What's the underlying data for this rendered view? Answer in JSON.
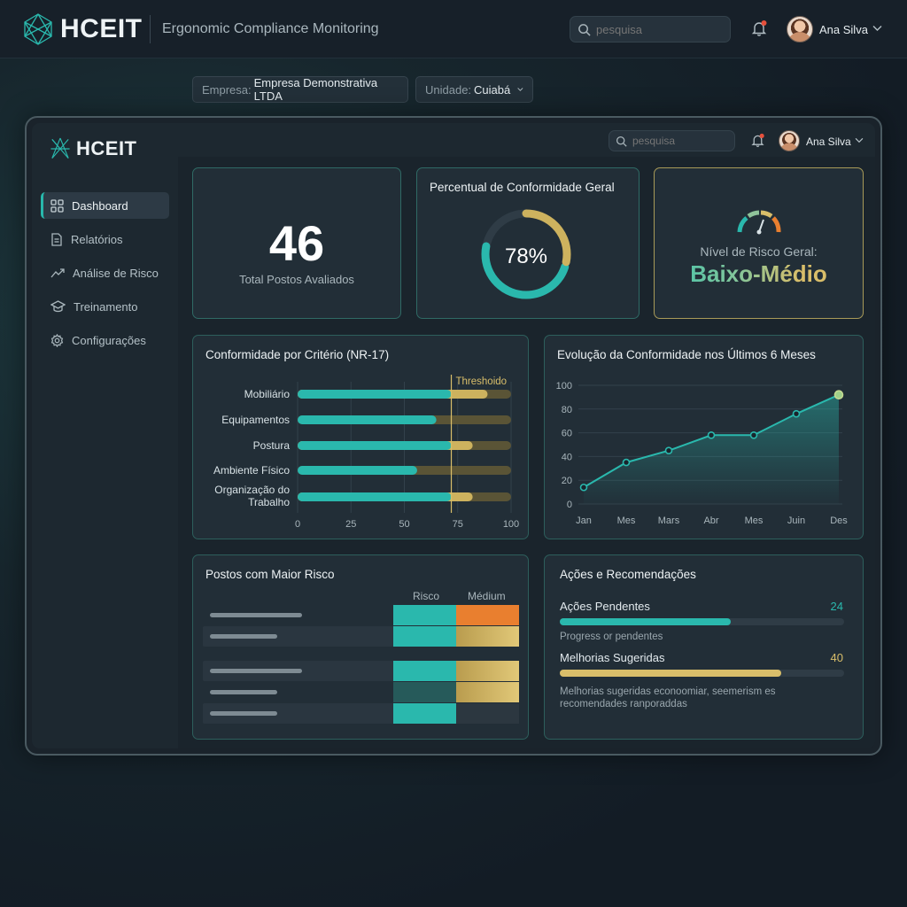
{
  "app": {
    "brand": "HCEIT",
    "subtitle": "Ergonomic Compliance Monitoring",
    "search_placeholder": "pesquisa",
    "user_name": "Ana Silva"
  },
  "filters": {
    "empresa_label": "Empresa:",
    "empresa_value": "Empresa Demonstrativa LTDA",
    "unidade_label": "Unidade:",
    "unidade_value": "Cuiabá"
  },
  "sidebar": {
    "items": [
      {
        "label": "Dashboard",
        "icon": "dashboard-grid-icon",
        "active": true
      },
      {
        "label": "Relatórios",
        "icon": "document-icon",
        "active": false
      },
      {
        "label": "Análise de Risco",
        "icon": "trend-chart-icon",
        "active": false
      },
      {
        "label": "Treinamento",
        "icon": "graduation-cap-icon",
        "active": false
      },
      {
        "label": "Configurações",
        "icon": "gear-icon",
        "active": false
      }
    ]
  },
  "kpis": {
    "total_value": "46",
    "total_label": "Total Postos Avaliados",
    "conformity_title": "Percentual de Conformidade Geral",
    "conformity_value": "78%",
    "conformity_fraction": 0.78,
    "risk_label": "Nível de Risco Geral:",
    "risk_value": "Baixo-Médio"
  },
  "colors": {
    "teal": "#2ab8ad",
    "gold": "#cdb25e",
    "orange": "#e97f2f",
    "track": "#5a5436"
  },
  "risk_table": {
    "title": "Postos com Maior Risco",
    "col_risk": "Risco",
    "col_medium": "Médium",
    "rows": [
      {
        "bar": 0.45,
        "risk": "#2ab8ad",
        "medium": "#e97f2f",
        "shade": false
      },
      {
        "bar": 0.33,
        "risk": "#2ab8ad",
        "medium": "#cdb25e",
        "shade": true
      },
      {
        "bar": 0.45,
        "risk": "#2ab8ad",
        "medium": "#cdb25e",
        "shade": true
      },
      {
        "bar": 0.33,
        "risk": "#265a5a",
        "medium": "#cdb25e",
        "shade": false
      },
      {
        "bar": 0.33,
        "risk": "#2ab8ad",
        "medium": "#2c3740",
        "shade": true
      }
    ]
  },
  "actions": {
    "title": "Ações e Recomendações",
    "pending_label": "Ações Pendentes",
    "pending_value": "24",
    "pending_progress": 0.6,
    "pending_note": "Progress or pendentes",
    "improve_label": "Melhorias Sugeridas",
    "improve_value": "40",
    "improve_progress": 0.78,
    "improve_note": "Melhorias sugeridas econoomiar, seemerism es recomendades ranporaddas"
  },
  "chart_data": [
    {
      "type": "bar",
      "title": "Conformidade por Critério (NR-17)",
      "orientation": "horizontal",
      "categories": [
        "Mobiliário",
        "Equipamentos",
        "Postura",
        "Ambiente Físico",
        "Organização do Trabalho"
      ],
      "series": [
        {
          "values": [
            89,
            65,
            82,
            56,
            82
          ]
        }
      ],
      "threshold": {
        "value": 72,
        "label": "Threshoido"
      },
      "xlim": [
        0,
        100
      ],
      "xticks": [
        0,
        25,
        50,
        75,
        100
      ],
      "grid": true
    },
    {
      "type": "area",
      "title": "Evolução da Conformidade nos Últimos 6 Meses",
      "x": [
        "Jan",
        "Mes",
        "Mars",
        "Abr",
        "Mes",
        "Juin",
        "Des"
      ],
      "y": [
        14,
        35,
        45,
        58,
        58,
        76,
        92
      ],
      "ylim": [
        0,
        100
      ],
      "yticks": [
        0,
        20,
        40,
        60,
        80,
        100
      ],
      "grid": true
    }
  ]
}
